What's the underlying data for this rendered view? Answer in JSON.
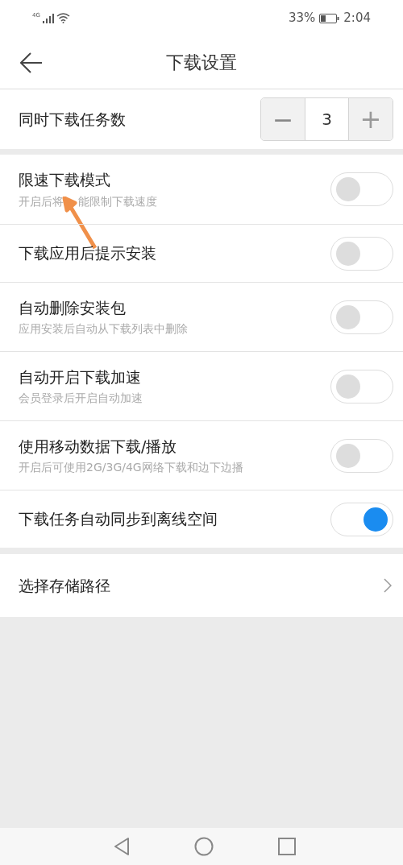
{
  "status_bar": {
    "network": "4G",
    "battery_percent": "33%",
    "time": "2:04"
  },
  "header": {
    "title": "下载设置"
  },
  "concurrent_tasks": {
    "label": "同时下载任务数",
    "value": "3",
    "minus": "—",
    "plus": "+"
  },
  "toggles": [
    {
      "title": "限速下载模式",
      "subtitle": [
        "开启后将",
        "能限制下载速度"
      ],
      "on": false,
      "annotated": true
    },
    {
      "title": "下载应用后提示安装",
      "on": false
    },
    {
      "title": "自动删除安装包",
      "subtitle": [
        "应用安装后自动从下载列表中删除"
      ],
      "on": false
    },
    {
      "title": "自动开启下载加速",
      "subtitle": [
        "会员登录后开启自动加速"
      ],
      "on": false
    },
    {
      "title": "使用移动数据下载/播放",
      "subtitle": [
        "开启后可使用2G/3G/4G网络下载和边下边播"
      ],
      "on": false
    },
    {
      "title": "下载任务自动同步到离线空间",
      "on": true
    }
  ],
  "storage": {
    "label": "选择存储路径"
  }
}
